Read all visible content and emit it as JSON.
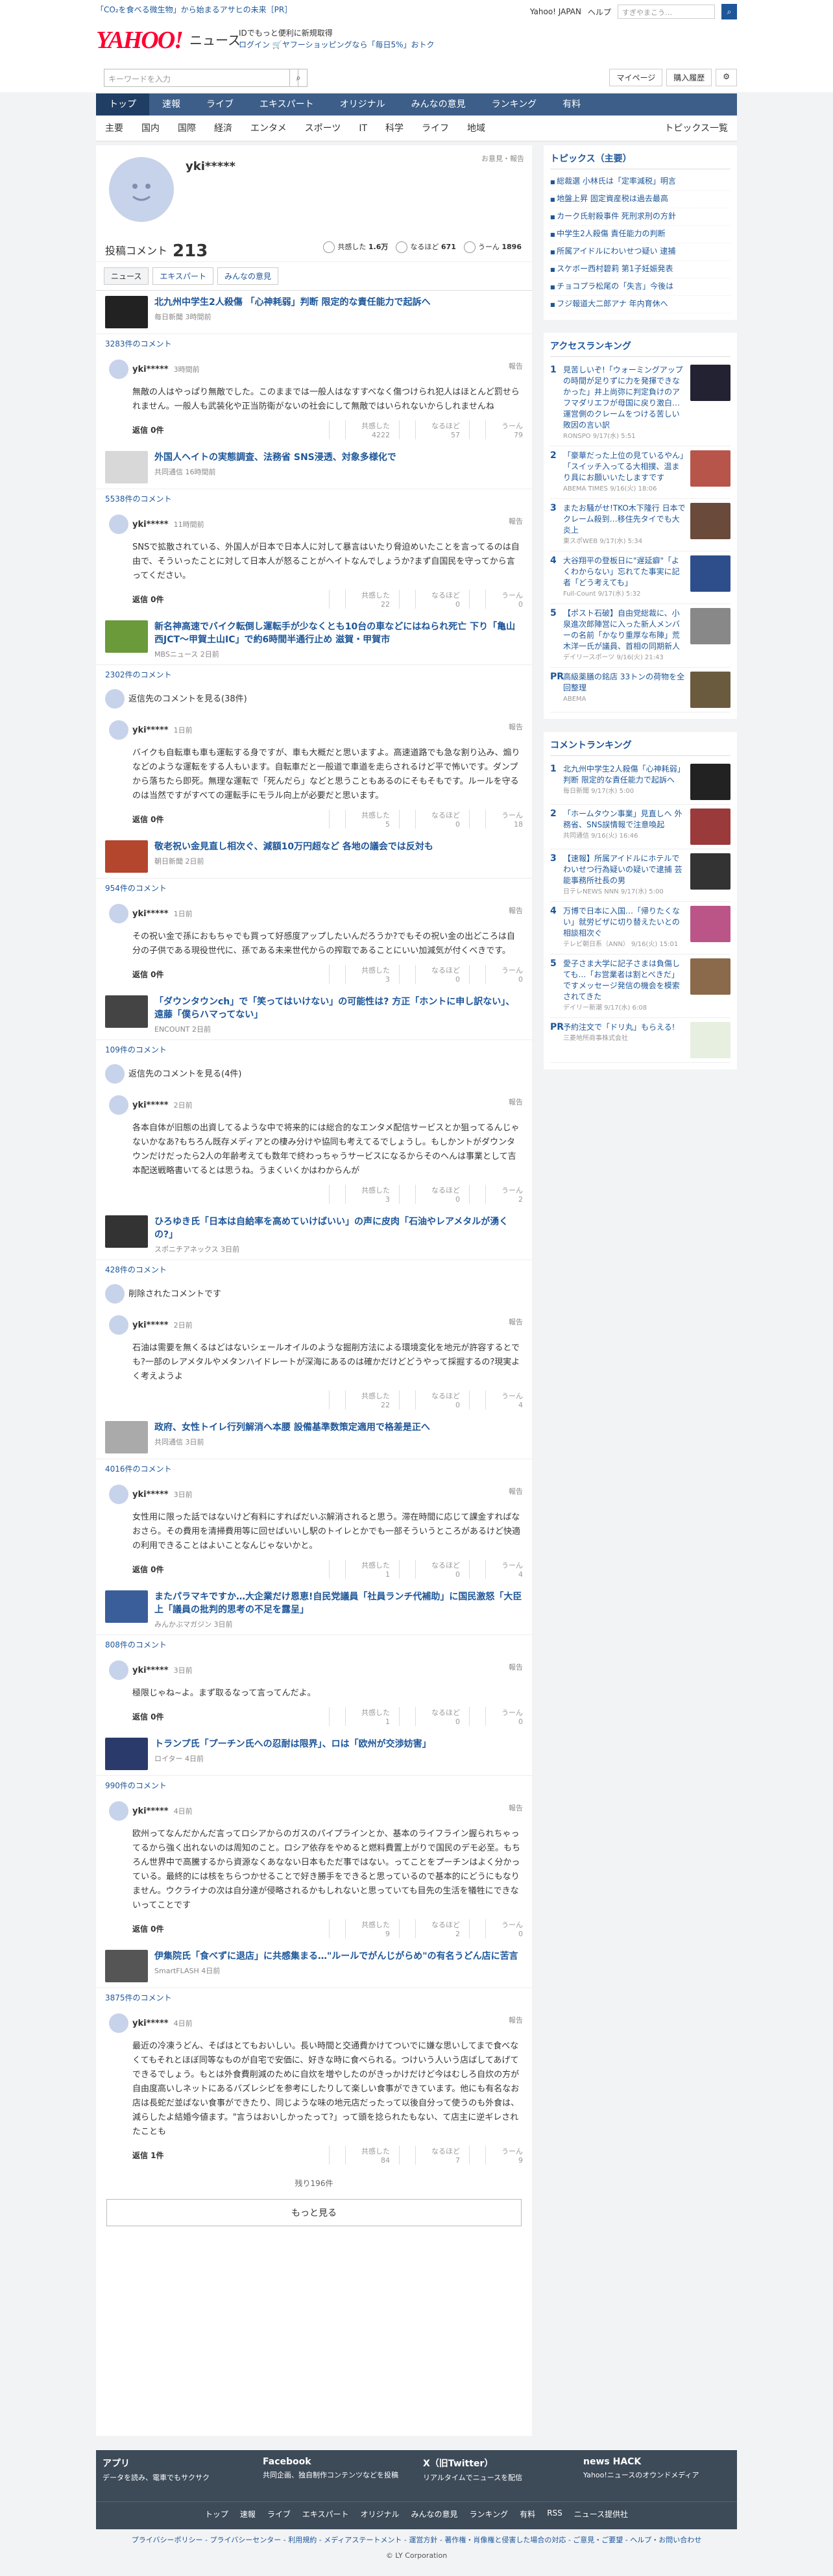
{
  "header": {
    "promo": "「CO₂を食べる微生物」から始まるアサヒの未来［PR］",
    "links": [
      "Yahoo! JAPAN",
      "ヘルプ"
    ],
    "search_placeholder": "ウェブ検索",
    "search_btn": "すぎやまこう…",
    "logo": "YAHOO!",
    "logo_sub": "ニュース",
    "id_line1": "IDでもっと便利に新規取得",
    "id_line2": "ログイン 🛒ヤフーショッピングなら「毎日5%」おトク"
  },
  "search": {
    "placeholder": "キーワードを入力",
    "mypage": "マイページ",
    "history": "購入履歴"
  },
  "nav": [
    "トップ",
    "速報",
    "ライブ",
    "エキスパート",
    "オリジナル",
    "みんなの意見",
    "ランキング",
    "有料"
  ],
  "subnav": [
    "主要",
    "国内",
    "国際",
    "経済",
    "エンタメ",
    "スポーツ",
    "IT",
    "科学",
    "ライフ",
    "地域"
  ],
  "subnav_right": "トピックス一覧",
  "profile": {
    "name": "yki*****",
    "report": "お意見・報告",
    "label": "投稿コメント",
    "count": "213",
    "reacts": [
      {
        "label": "共感した",
        "val": "1.6万"
      },
      {
        "label": "なるほど",
        "val": "671"
      },
      {
        "label": "うーん",
        "val": "1896"
      }
    ]
  },
  "tabs": [
    "ニュース",
    "エキスパート",
    "みんなの意見"
  ],
  "items": [
    {
      "title": "北九州中学生2人殺傷 「心神耗弱」判断 限定的な責任能力で起訴へ",
      "src": "毎日新聞 3時間前",
      "count": "3283件のコメント",
      "name": "yki*****",
      "time": "3時間前",
      "text": "無敵の人はやっぱり無敵でした。このままでは一般人はなすすべなく傷つけられ犯人はほとんど罰せられません。一般人も武装化や正当防衛がないの社会にして無敵ではいられないからしれませんね",
      "r": [
        "4222",
        "57",
        "79"
      ],
      "reply": "返信 0件",
      "col": "#222"
    },
    {
      "title": "外国人ヘイトの実態調査、法務省 SNS浸透、対象多様化で",
      "src": "共同通信 16時間前",
      "count": "5538件のコメント",
      "name": "yki*****",
      "time": "11時間前",
      "text": "SNSで拡散されている、外国人が日本で日本人に対して暴言はいたり脅迫めいたことを言ってるのは自由で、そういったことに対して日本人が怒ることがヘイトなんでしょうか?まず自国民を守ってから言ってください。",
      "r": [
        "22",
        "0",
        "0"
      ],
      "reply": "返信 0件",
      "col": "#d8d8d8"
    },
    {
      "title": "新名神高速でバイク転倒し運転手が少なくとも10台の車などにはねられ死亡 下り「亀山西JCT〜甲賀土山IC」で約6時間半通行止め 滋賀・甲賀市",
      "src": "MBSニュース 2日前",
      "count": "2302件のコメント",
      "name": "yki*****",
      "time": "1日前",
      "text": "バイクも自転車も車も運転する身ですが、車も大概だと思いますよ。高速道路でも急な割り込み、煽りなどのような運転をする人もいます。自転車だと一般道で車道を走らされるけど平で怖いです。ダンプから落ちたら即死。無理な運転で「死んだら」などと思うこともあるのにそもそもです。ルールを守るのは当然ですがすべての運転手にモラル向上が必要だと思います。",
      "r": [
        "5",
        "0",
        "18"
      ],
      "reply": "返信 0件",
      "col": "#6a9a3a",
      "prev": "返信先のコメントを見る(38件)"
    },
    {
      "title": "敬老祝い金見直し相次ぐ、減額10万円超など 各地の議会では反対も",
      "src": "朝日新聞 2日前",
      "count": "954件のコメント",
      "name": "yki*****",
      "time": "1日前",
      "text": "その祝い金で孫におもちゃでも買って好感度アップしたいんだろうか?でもその祝い金の出どころは自分の子供である現役世代に、孫である未来世代からの搾取であることにいい加減気が付くべきです。",
      "r": [
        "3",
        "0",
        "0"
      ],
      "reply": "返信 0件",
      "col": "#b4462e"
    },
    {
      "title": "「ダウンタウンch」で「笑ってはいけない」の可能性は? 方正「ホントに申し訳ない」、遠藤「僕らハマってない」",
      "src": "ENCOUNT 2日前",
      "count": "109件のコメント",
      "name": "yki*****",
      "time": "2日前",
      "text": "各本自体が旧態の出資してるような中で将来的には総合的なエンタメ配信サービスとか狙ってるんじゃないかなあ?もちろん既存メディアとの棲み分けや協同も考えてるでしょうし。もしかントがダウンタウンだけだったら2人の年齢考えても数年で終わっちゃうサービスになるからそのへんは事業として吉本配送戦略書いてるとは思うね。うまくいくかはわからんが",
      "r": [
        "3",
        "0",
        "2"
      ],
      "reply": "",
      "col": "#444",
      "prev": "返信先のコメントを見る(4件)"
    },
    {
      "title": "ひろゆき氏「日本は自給率を高めていけばいい」の声に皮肉「石油やレアメタルが湧くの?」",
      "src": "スポニチアネックス 3日前",
      "count": "428件のコメント",
      "name": "yki*****",
      "time": "2日前",
      "text": "石油は需要を無くるはどはないシェールオイルのような掘削方法による環境変化を地元が許容するとでも?一部のレアメタルやメタンハイドレートが深海にあるのは確かだけどどうやって採掘するの?現実よく考えようよ",
      "r": [
        "22",
        "0",
        "4"
      ],
      "reply": "",
      "col": "#333",
      "prev": "削除されたコメントです"
    },
    {
      "title": "政府、女性トイレ行列解消へ本腰 設備基準数策定適用で格差是正へ",
      "src": "共同通信 3日前",
      "count": "4016件のコメント",
      "name": "yki*****",
      "time": "3日前",
      "text": "女性用に限った話ではないけど有料にすればだいぶ解消されると思う。滞在時間に応じて課金すればなおさら。その費用を清掃費用等に回せばいいし駅のトイレとかでも一部そういうところがあるけど快適の利用できることはよいことなんじゃないかと。",
      "r": [
        "1",
        "0",
        "4"
      ],
      "reply": "返信 0件",
      "col": "#aaa"
    },
    {
      "title": "またパラマキですか…大企業だけ恩恵!自民党議員「社員ランチ代補助」に国民激怒「大臣上「議員の批判的思考の不足を露呈」",
      "src": "みんかぶマガジン 3日前",
      "count": "808件のコメント",
      "name": "yki*****",
      "time": "3日前",
      "text": "極限じゃね~よ。まず取るなって言ってんだよ。",
      "r": [
        "1",
        "0",
        "0"
      ],
      "reply": "返信 0件",
      "col": "#3a5e9a"
    },
    {
      "title": "トランプ氏「プーチン氏への忍耐は限界」、ロは「欧州が交渉妨害」",
      "src": "ロイター 4日前",
      "count": "990件のコメント",
      "name": "yki*****",
      "time": "4日前",
      "text": "欧州ってなんだかんだ言ってロシアからのガスのパイプラインとか、基本のライフライン握られちゃってるから強く出れないのは周知のこと。ロシア依存をやめると燃料費置上がりで国民のデモ必至。もちろん世界中で高騰するから資源なくあなない日本もただ事ではない。ってことをプーチンはよく分かっている。最終的には核をちらつかせることで好き勝手をできると思っているので基本的にどうにもなりません。ウクライナの次は自分達が侵略されるかもしれないと思っていても目先の生活を犠牲にできないってことです",
      "r": [
        "9",
        "2",
        "0"
      ],
      "reply": "返信 0件",
      "col": "#2a3a6a"
    },
    {
      "title": "伊集院氏「食べずに退店」に共感集まる…\"ルールでがんじがらめ\"の有名うどん店に苦言",
      "src": "SmartFLASH 4日前",
      "count": "3875件のコメント",
      "name": "yki*****",
      "time": "4日前",
      "text": "最近の冷凍うどん、そばはとてもおいしい。長い時間と交通費かけてついでに嫌な思いしてまで食べなくてもそれとほぼ同等なものが自宅で安価に、好きな時に食べられる。つけいう人いう店ばしてあげてできるでしょう。もとは外食費削減のために自炊を増やしたのがきっかけだけど今はむしろ自炊の方が自由度高いしネットにあるバズレシピを参考にしたりして楽しい食事ができています。他にも有名なお店は長蛇だ並ばない食事ができたり、同じような味の地元店だったって以後自分って使うのも外食は、減らしたよ結婚今値ます。\"言うはおいしかったって?」って頭を捻られたもない、て店主に逆ギレされたことも",
      "r": [
        "84",
        "7",
        "9"
      ],
      "reply": "返信 1件",
      "col": "#555"
    }
  ],
  "more_note": "残り196件",
  "more_btn": "もっと見る",
  "topics": {
    "title": "トピックス（主要）",
    "items": [
      "総裁選 小林氏は「定率減税」明言",
      "地盤上昇 固定資産税は過去最高",
      "カーク氏射殺事件 死刑求刑の方針",
      "中学生2人殺傷 責任能力の判断",
      "所属アイドルにわいせつ疑い 逮捕",
      "スケボー西村碧莉 第1子妊娠発表",
      "チョコプラ松尾の「失言」今後は",
      "フジ報道大二郎アナ 年内育休へ"
    ]
  },
  "access": {
    "title": "アクセスランキング",
    "items": [
      {
        "t": "見苦しいぞ!「ウォーミングアップの時間が足りずに力を発揮できなかった」井上尚弥に判定負けのアフマダリエフが母国に戻り激白…運営側のクレームをつける苦しい敗因の言い訳",
        "m": "RONSPO 9/17(水) 5:51",
        "c": "#223"
      },
      {
        "t": "「豪華だった上位の見ているやん」「スイッチ入ってる大相撲、温まり具にお願いいたしますです",
        "m": "ABEMA TIMES 9/16(火) 18:06",
        "c": "#b8554a"
      },
      {
        "t": "またお騒がせ!TKO木下隆行 日本でクレーム殺到…移住先タイでも大炎上",
        "m": "東スポWEB 9/17(水) 5:34",
        "c": "#6a4a3a"
      },
      {
        "t": "大谷翔平の登板日に\"遅延癖\"「よくわからない」忘れてた事実に記者「どう考えても」",
        "m": "Full-Count 9/17(水) 5:32",
        "c": "#2d4e8a"
      },
      {
        "t": "【ポスト石破】自由党総裁に、小泉進次郎陣営に入った新人メンバーの名前「かなり重厚な布陣」荒木洋一氏が議員、首相の同期新人",
        "m": "デイリースポーツ 9/16(火) 21:43",
        "c": "#888"
      }
    ]
  },
  "ad_top": {
    "t": "高級薬膳の銘店 33トンの荷物を全回整理",
    "m": "ABEMA"
  },
  "cranking": {
    "title": "コメントランキング",
    "items": [
      {
        "t": "北九州中学生2人殺傷「心神耗弱」判断 限定的な責任能力で起訴へ",
        "m": "毎日新聞 9/17(水) 5:00",
        "c": "#222"
      },
      {
        "t": "「ホームタウン事業」見直しへ 外務省、SNS誤情報で注意喚起",
        "m": "共同通信 9/16(火) 16:46",
        "c": "#9a3a3a"
      },
      {
        "t": "【速報】所属アイドルにホテルでわいせつ行為疑いの疑いで逮捕 芸能事務所社長の男",
        "m": "日テレNEWS NNN 9/17(水) 5:00",
        "c": "#333"
      },
      {
        "t": "万博で日本に入国…「帰りたくない」就労ビザに切り替えたいとの相談相次ぐ",
        "m": "テレビ朝日系（ANN） 9/16(火) 15:01",
        "c": "#b58"
      },
      {
        "t": "愛子さま大学に記子さまは負傷しても…「お営業者は割とべきだ」ですメッセージ発信の機会を模索されてきた",
        "m": "デイリー新潮 9/17(水) 6:08",
        "c": "#8a6a4a"
      }
    ]
  },
  "ad_bottom": {
    "t": "予約注文で「ドリ丸」もらえる!",
    "m": "三菱地所商事株式会社"
  },
  "footer": {
    "cols": [
      {
        "h": "アプリ",
        "d": "データを読み、電車でもサクサク"
      },
      {
        "h": "Facebook",
        "d": "共同企画、独自制作コンテンツなどを投稿"
      },
      {
        "h": "X（旧Twitter）",
        "d": "リアルタイムでニュースを配信"
      },
      {
        "h": "news HACK",
        "d": "Yahoo!ニュースのオウンドメディア"
      }
    ],
    "nav": [
      "トップ",
      "速報",
      "ライブ",
      "エキスパート",
      "オリジナル",
      "みんなの意見",
      "ランキング",
      "有料",
      "RSS",
      "ニュース提供社"
    ],
    "legal": "プライバシーポリシー - プライバシーセンター - 利用規約 - メディアステートメント - 運営方針 - 著作権・肖像権と侵害した場合の対応 - ご意見・ご要望 - ヘルプ・お問い合わせ",
    "copy": "© LY Corporation"
  }
}
